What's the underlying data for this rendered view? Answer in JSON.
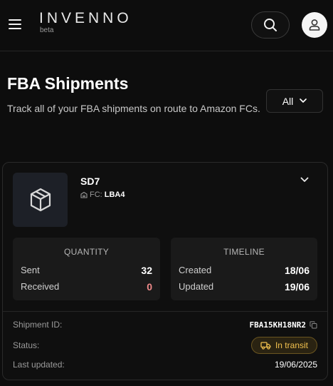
{
  "header": {
    "logo": "INVENNO",
    "logo_sub": "beta",
    "icons": {
      "menu": "hamburger-menu-icon",
      "search": "search-icon",
      "account": "user-icon"
    }
  },
  "page": {
    "title": "FBA Shipments",
    "subtitle": "Track all of your FBA shipments on route to Amazon FCs.",
    "filter": {
      "selected": "All",
      "icon": "chevron-down-icon"
    }
  },
  "shipment": {
    "name": "SD7",
    "fc_label": "FC:",
    "fc_code": "LBA4",
    "icons": {
      "thumb": "package-icon",
      "fc": "warehouse-icon",
      "expand": "chevron-down-icon"
    },
    "quantity": {
      "title": "QUANTITY",
      "sent_label": "Sent",
      "sent": "32",
      "received_label": "Received",
      "received": "0"
    },
    "timeline": {
      "title": "TIMELINE",
      "created_label": "Created",
      "created": "18/06",
      "updated_label": "Updated",
      "updated": "19/06"
    },
    "meta": {
      "id_label": "Shipment ID:",
      "id": "FBA15KH18NR2",
      "status_label": "Status:",
      "status": "In transit",
      "last_updated_label": "Last updated:",
      "last_updated": "19/06/2025"
    },
    "colors": {
      "status_text": "#f2c14e",
      "received_zero": "#f08a8a"
    }
  }
}
